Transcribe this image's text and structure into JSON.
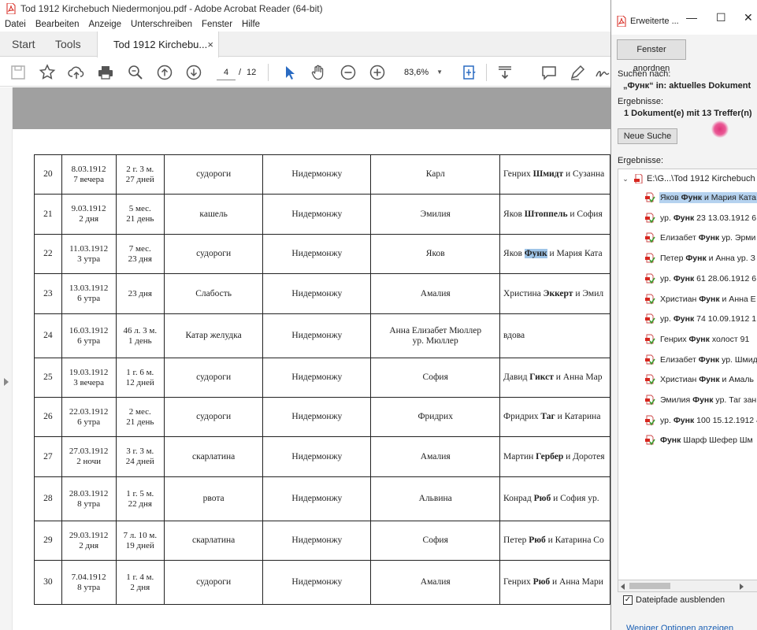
{
  "window": {
    "title": "Tod 1912  Kirchebuch Niedermonjou.pdf - Adobe Acrobat Reader (64-bit)"
  },
  "menu": [
    "Datei",
    "Bearbeiten",
    "Anzeige",
    "Unterschreiben",
    "Fenster",
    "Hilfe"
  ],
  "tabs": {
    "start": "Start",
    "tools": "Tools",
    "document": "Tod 1912  Kirchebu...",
    "close_glyph": "×"
  },
  "toolbar": {
    "page_current": "4",
    "page_separator": "/",
    "page_total": "12",
    "zoom": "83,6%",
    "icons": [
      "save-icon",
      "bookmark-star-icon",
      "upload-cloud-icon",
      "print-icon",
      "search-zoom-icon",
      "page-up-icon",
      "page-down-icon",
      "select-arrow-icon",
      "hand-icon",
      "zoom-out-icon",
      "zoom-in-icon",
      "fit-page-icon",
      "scroll-mode-icon",
      "comment-icon",
      "pen-icon",
      "sign-icon"
    ]
  },
  "table": {
    "rows": [
      {
        "num": "20",
        "date": "8.03.1912",
        "time": "7 вечера",
        "age1": "2 г. 3 м.",
        "age2": "27 дней",
        "cause": "судороги",
        "place": "Нидермонжу",
        "name": "Карл",
        "parents_pre": "Генрих ",
        "parents_bold": "Шмидт",
        "parents_post": " и Сузанна",
        "parents_hl": false
      },
      {
        "num": "21",
        "date": "9.03.1912",
        "time": "2 дня",
        "age1": "5 мес.",
        "age2": "21 день",
        "cause": "кашель",
        "place": "Нидермонжу",
        "name": "Эмилия",
        "parents_pre": "Яков ",
        "parents_bold": "Штоппель",
        "parents_post": " и София",
        "parents_hl": false
      },
      {
        "num": "22",
        "date": "11.03.1912",
        "time": "3 утра",
        "age1": "7 мес.",
        "age2": "23 дня",
        "cause": "судороги",
        "place": "Нидермонжу",
        "name": "Яков",
        "parents_pre": "Яков ",
        "parents_bold": "Функ",
        "parents_post": " и Мария Ката",
        "parents_hl": true
      },
      {
        "num": "23",
        "date": "13.03.1912",
        "time": "6 утра",
        "age1": "23 дня",
        "age2": "",
        "cause": "Слабость",
        "place": "Нидермонжу",
        "name": "Амалия",
        "parents_pre": "Христина ",
        "parents_bold": "Эккерт",
        "parents_post": " и Эмил",
        "parents_hl": false
      },
      {
        "num": "24",
        "date": "16.03.1912",
        "time": "6 утра",
        "age1": "46 л. 3 м.",
        "age2": "1 день",
        "cause": "Катар желудка",
        "place": "Нидермонжу",
        "name": "Анна Елизабет Мюллер",
        "name2": "ур. Мюллер",
        "parents_pre": "вдова",
        "parents_bold": "",
        "parents_post": "",
        "parents_hl": false
      },
      {
        "num": "25",
        "date": "19.03.1912",
        "time": "3 вечера",
        "age1": "1 г. 6 м.",
        "age2": "12 дней",
        "cause": "судороги",
        "place": "Нидермонжу",
        "name": "София",
        "parents_pre": "Давид ",
        "parents_bold": "Гикст",
        "parents_post": " и Анна Мар",
        "parents_hl": false
      },
      {
        "num": "26",
        "date": "22.03.1912",
        "time": "6 утра",
        "age1": "2 мес.",
        "age2": "21 день",
        "cause": "судороги",
        "place": "Нидермонжу",
        "name": "Фридрих",
        "parents_pre": "Фридрих ",
        "parents_bold": "Таг",
        "parents_post": " и Катарина",
        "parents_hl": false
      },
      {
        "num": "27",
        "date": "27.03.1912",
        "time": "2 ночи",
        "age1": "3 г. 3 м.",
        "age2": "24 дней",
        "cause": "скарлатина",
        "place": "Нидермонжу",
        "name": "Амалия",
        "parents_pre": "Мартин ",
        "parents_bold": "Гербер",
        "parents_post": " и Доротея",
        "parents_hl": false
      },
      {
        "num": "28",
        "date": "28.03.1912",
        "time": "8 утра",
        "age1": "1 г. 5 м.",
        "age2": "22 дня",
        "cause": "рвота",
        "place": "Нидермонжу",
        "name": "Альвина",
        "parents_pre": "Конрад ",
        "parents_bold": "Рюб",
        "parents_post": " и София ур.",
        "parents_hl": false
      },
      {
        "num": "29",
        "date": "29.03.1912",
        "time": "2 дня",
        "age1": "7 л. 10 м.",
        "age2": "19 дней",
        "cause": "скарлатина",
        "place": "Нидермонжу",
        "name": "София",
        "parents_pre": "Петер ",
        "parents_bold": "Рюб",
        "parents_post": " и Катарина Со",
        "parents_hl": false
      },
      {
        "num": "30",
        "date": "7.04.1912",
        "time": "8 утра",
        "age1": "1 г. 4 м.",
        "age2": "2 дня",
        "cause": "судороги",
        "place": "Нидермонжу",
        "name": "Амалия",
        "parents_pre": "Генрих ",
        "parents_bold": "Рюб",
        "parents_post": " и Анна Мари",
        "parents_hl": false
      }
    ]
  },
  "panel": {
    "title": "Erweiterte ...",
    "arrange_button": "Fenster anordnen",
    "search_for_label": "Suchen nach:",
    "search_for_value": "„Функ“ in: aktuelles Dokument",
    "results_label": "Ergebnisse:",
    "results_summary": "1 Dokument(e) mit 13 Treffer(n)",
    "new_search_button": "Neue Suche",
    "results_list_label": "Ergebnisse:",
    "tree_root": "E:\\G...\\Tod 1912  Kirchebuch",
    "results": [
      {
        "pre": "Яков ",
        "bold": "Функ",
        "post": " и Мария Ката"
      },
      {
        "pre": "ур. ",
        "bold": "Функ",
        "post": " 23 13.03.1912 6"
      },
      {
        "pre": "Елизабет ",
        "bold": "Функ",
        "post": " ур. Эрми"
      },
      {
        "pre": "Петер ",
        "bold": "Функ",
        "post": " и Анна ур. З"
      },
      {
        "pre": "ур. ",
        "bold": "Функ",
        "post": " 61 28.06.1912 6"
      },
      {
        "pre": "Христиан ",
        "bold": "Функ",
        "post": " и Анна Е"
      },
      {
        "pre": "ур. ",
        "bold": "Функ",
        "post": " 74 10.09.1912 1"
      },
      {
        "pre": "Генрих ",
        "bold": "Функ",
        "post": " холост 91"
      },
      {
        "pre": "Елизабет ",
        "bold": "Функ",
        "post": " ур. Шмид"
      },
      {
        "pre": "Христиан ",
        "bold": "Функ",
        "post": " и Амаль"
      },
      {
        "pre": "Эмилия ",
        "bold": "Функ",
        "post": " ур. Таг зан"
      },
      {
        "pre": "ур. ",
        "bold": "Функ",
        "post": " 100 15.12.1912 4"
      },
      {
        "pre": "",
        "bold": "Функ",
        "post": " Шарф Шефер Шм"
      }
    ],
    "hide_paths_label": "Dateipfade ausblenden",
    "hide_paths_checked": "✓",
    "fewer_options_link": "Weniger Optionen anzeigen"
  },
  "colors": {
    "acrobat_red": "#d7261e",
    "highlight": "#9ec4e8",
    "selected_result": "#b5d2ef",
    "icon_blue": "#2a6bc2"
  }
}
